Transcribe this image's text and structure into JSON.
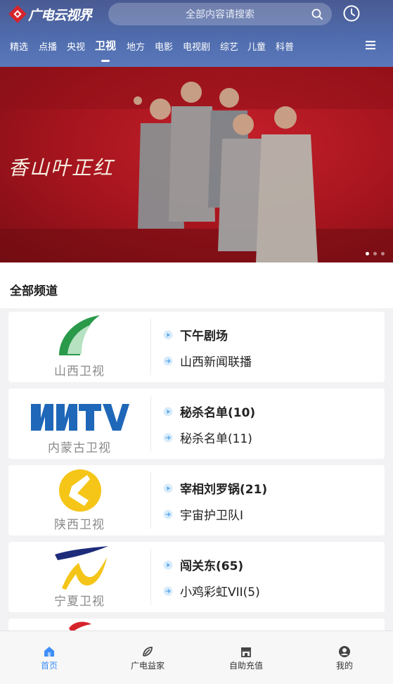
{
  "header": {
    "logo_text": "广电云视界",
    "search_placeholder": "全部内容请搜索",
    "nav_tabs": [
      {
        "label": "精选"
      },
      {
        "label": "点播"
      },
      {
        "label": "央视"
      },
      {
        "label": "卫视",
        "active": true
      },
      {
        "label": "地方"
      },
      {
        "label": "电影"
      },
      {
        "label": "电视剧"
      },
      {
        "label": "综艺"
      },
      {
        "label": "儿童"
      },
      {
        "label": "科普"
      }
    ]
  },
  "banner": {
    "title": "香山叶正红",
    "slide_count": 3,
    "active_slide": 1
  },
  "section": {
    "title": "全部频道"
  },
  "channels": [
    {
      "name": "山西卫视",
      "now": "下午剧场",
      "next": "山西新闻联播"
    },
    {
      "name": "内蒙古卫视",
      "now": "秘杀名单(10)",
      "next": "秘杀名单(11)"
    },
    {
      "name": "陕西卫视",
      "now": "宰相刘罗锅(21)",
      "next": "宇宙护卫队I"
    },
    {
      "name": "宁夏卫视",
      "now": "闯关东(65)",
      "next": "小鸡彩虹VII(5)"
    }
  ],
  "tabbar": {
    "items": [
      {
        "label": "首页",
        "icon": "home-icon",
        "active": true
      },
      {
        "label": "广电益家",
        "icon": "leaf-icon"
      },
      {
        "label": "自助充值",
        "icon": "store-icon"
      },
      {
        "label": "我的",
        "icon": "user-icon"
      }
    ]
  },
  "colors": {
    "accent": "#3e8ef7",
    "header": "#4f6cad",
    "banner": "#b3161f"
  }
}
